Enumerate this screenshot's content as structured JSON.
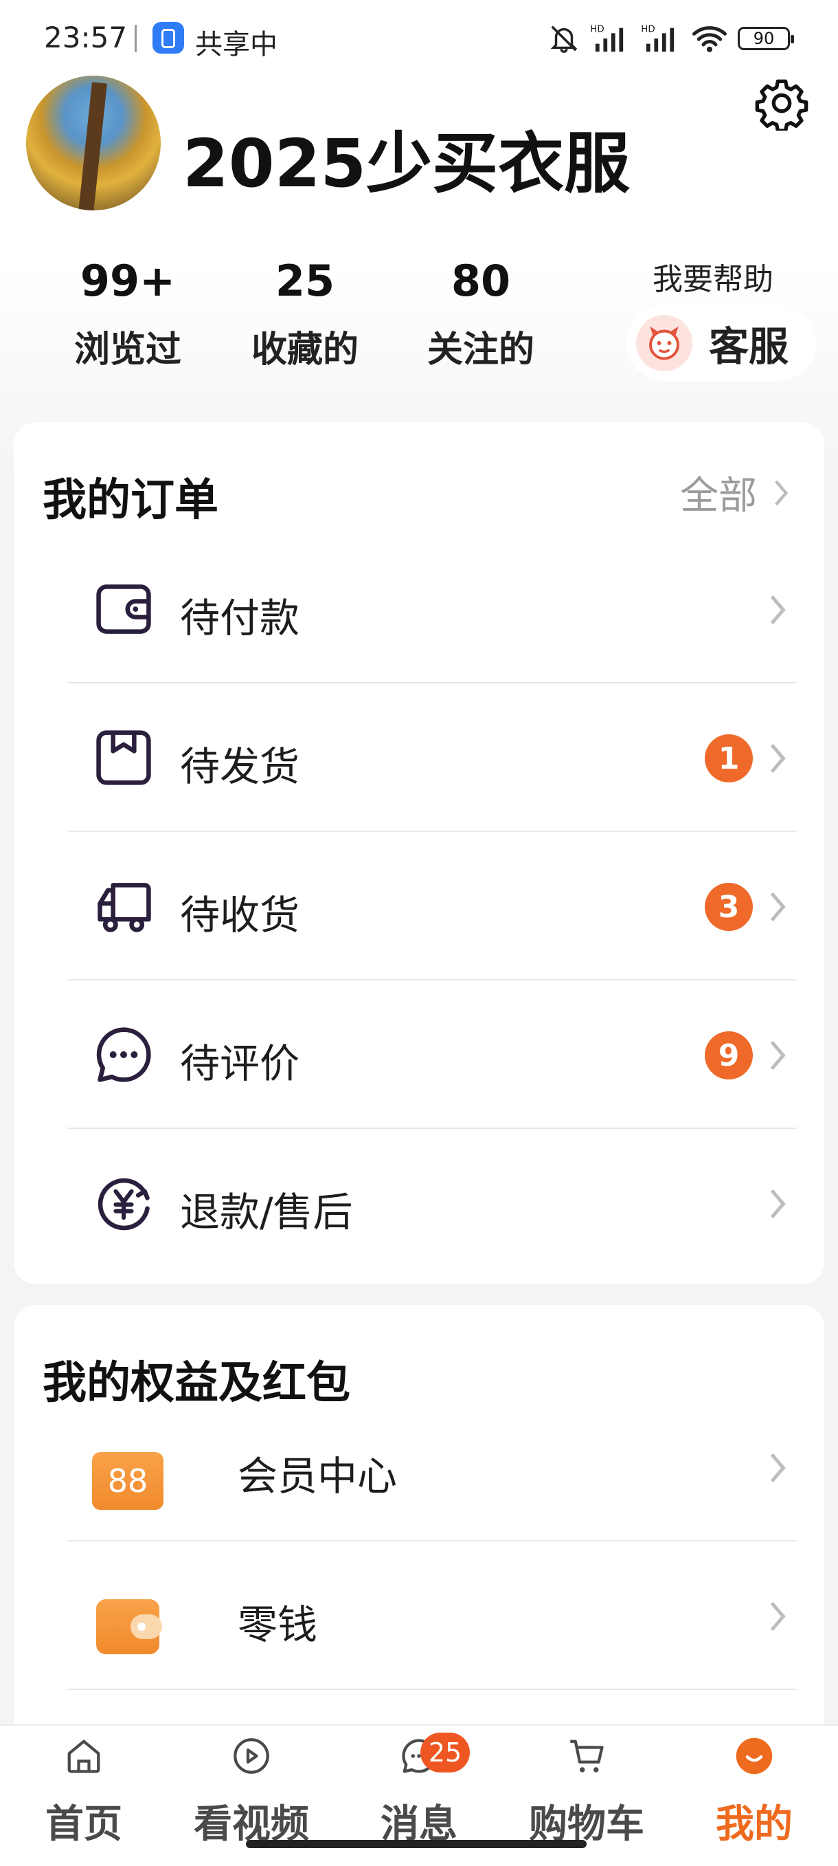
{
  "status_bar": {
    "time": "23:57",
    "sharing_label": "共享中",
    "battery": "90",
    "icons": [
      "mute-bell-icon",
      "hd-signal-icon",
      "hd-signal-icon",
      "wifi-icon",
      "battery-icon"
    ]
  },
  "profile": {
    "username": "2025少买衣服",
    "stats": [
      {
        "value": "99+",
        "label": "浏览过"
      },
      {
        "value": "25",
        "label": "收藏的"
      },
      {
        "value": "80",
        "label": "关注的"
      }
    ],
    "help_title": "我要帮助",
    "customer_service_label": "客服"
  },
  "orders": {
    "title": "我的订单",
    "all_label": "全部",
    "items": [
      {
        "label": "待付款",
        "icon": "wallet-icon",
        "badge": null
      },
      {
        "label": "待发货",
        "icon": "package-icon",
        "badge": "1"
      },
      {
        "label": "待收货",
        "icon": "truck-icon",
        "badge": "3"
      },
      {
        "label": "待评价",
        "icon": "comment-icon",
        "badge": "9"
      },
      {
        "label": "退款/售后",
        "icon": "refund-icon",
        "badge": null
      }
    ]
  },
  "rights": {
    "title": "我的权益及红包",
    "items": [
      {
        "label": "会员中心",
        "icon": "vip-icon",
        "icon_text": "88"
      },
      {
        "label": "零钱",
        "icon": "change-wallet-icon"
      }
    ]
  },
  "bottom_nav": {
    "items": [
      {
        "label": "首页",
        "icon": "home-icon"
      },
      {
        "label": "看视频",
        "icon": "play-icon"
      },
      {
        "label": "消息",
        "icon": "message-icon",
        "badge": "25"
      },
      {
        "label": "购物车",
        "icon": "cart-icon"
      },
      {
        "label": "我的",
        "icon": "profile-icon",
        "active": true
      }
    ]
  },
  "colors": {
    "accent": "#ee6a1e",
    "badge": "#ef6a2a",
    "icon_dark": "#2a1f3d"
  }
}
